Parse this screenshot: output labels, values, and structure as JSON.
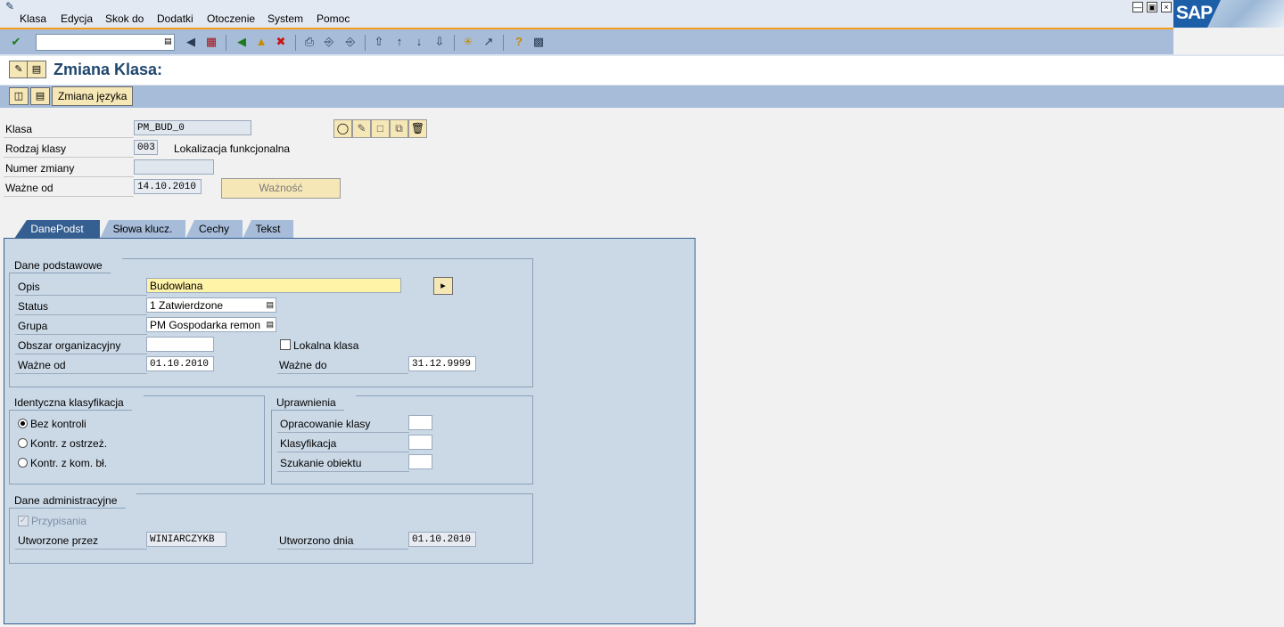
{
  "menu": {
    "items": [
      "Klasa",
      "Edycja",
      "Skok do",
      "Dodatki",
      "Otoczenie",
      "System",
      "Pomoc"
    ],
    "logo_text": "SAP"
  },
  "title": "Zmiana Klasa:",
  "app_toolbar": {
    "language_button": "Zmiana języka"
  },
  "header": {
    "klasa_label": "Klasa",
    "klasa_value": "PM_BUD_0",
    "rodzaj_label": "Rodzaj klasy",
    "rodzaj_value": "003",
    "rodzaj_text": "Lokalizacja funkcjonalna",
    "numer_label": "Numer zmiany",
    "numer_value": "",
    "wazne_label": "Ważne od",
    "wazne_value": "14.10.2010",
    "waznosc_button": "Ważność"
  },
  "tabs": [
    {
      "label": "DanePodst",
      "active": true
    },
    {
      "label": "Słowa klucz.",
      "active": false
    },
    {
      "label": "Cechy",
      "active": false
    },
    {
      "label": "Tekst",
      "active": false
    }
  ],
  "basic_data": {
    "title": "Dane podstawowe",
    "opis_label": "Opis",
    "opis_value": "Budowlana",
    "status_label": "Status",
    "status_value": "1 Zatwierdzone",
    "grupa_label": "Grupa",
    "grupa_value": "PM Gospodarka remon",
    "obszar_label": "Obszar organizacyjny",
    "obszar_value": "",
    "lokalna_label": "Lokalna klasa",
    "lokalna_checked": false,
    "wazne_od_label": "Ważne od",
    "wazne_od_value": "01.10.2010",
    "wazne_do_label": "Ważne do",
    "wazne_do_value": "31.12.9999"
  },
  "identical": {
    "title": "Identyczna klasyfikacja",
    "options": [
      "Bez kontroli",
      "Kontr. z ostrzeż.",
      "Kontr. z kom. bł."
    ],
    "selected_index": 0
  },
  "auth": {
    "title": "Uprawnienia",
    "opracowanie_label": "Opracowanie klasy",
    "opracowanie_value": "",
    "klasyfikacja_label": "Klasyfikacja",
    "klasyfikacja_value": "",
    "szukanie_label": "Szukanie obiektu",
    "szukanie_value": ""
  },
  "admin": {
    "title": "Dane administracyjne",
    "przypisania_label": "Przypisania",
    "przypisania_checked": true,
    "utworzone_przez_label": "Utworzone przez",
    "utworzone_przez_value": "WINIARCZYKB",
    "utworzono_dnia_label": "Utworzono dnia",
    "utworzono_dnia_value": "01.10.2010"
  },
  "colors": {
    "toolbar": "#a6bcd9",
    "accent_orange": "#f29e1a",
    "tab_active": "#355f91",
    "panel": "#cbd9e7",
    "required_field": "#fff3a8",
    "button": "#f6e7b6"
  }
}
